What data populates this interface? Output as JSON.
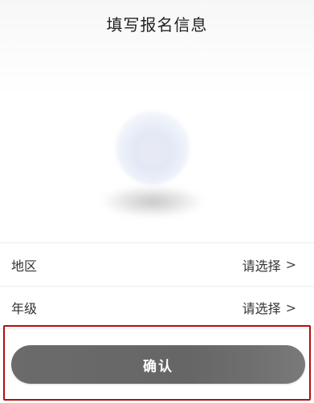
{
  "header": {
    "title": "填写报名信息"
  },
  "avatar": {
    "icon": "avatar-placeholder-icon"
  },
  "form": {
    "rows": [
      {
        "label": "地区",
        "value": "请选择",
        "chevron": ">"
      },
      {
        "label": "年级",
        "value": "请选择",
        "chevron": ">"
      }
    ]
  },
  "actions": {
    "confirm_label": "确认",
    "highlight_color": "#b40e0e",
    "button_color": "#666666"
  }
}
